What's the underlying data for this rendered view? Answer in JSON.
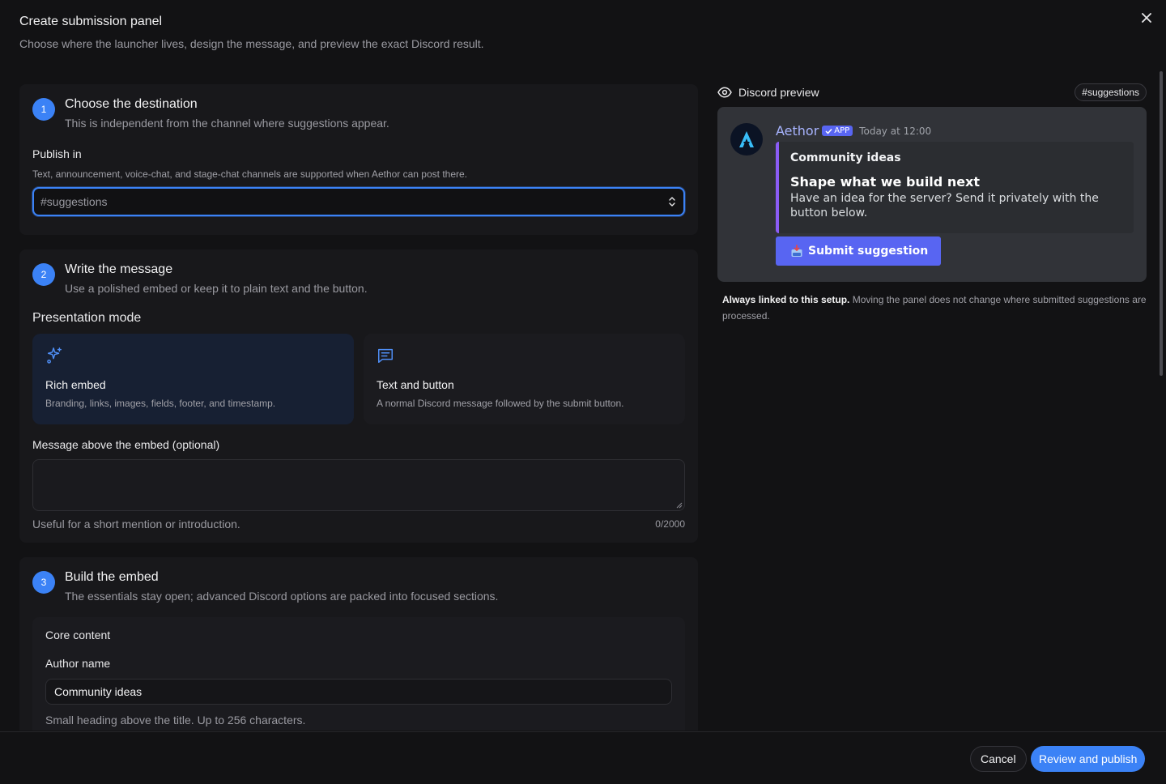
{
  "header": {
    "title": "Create submission panel",
    "subtitle": "Choose where the launcher lives, design the message, and preview the exact Discord result."
  },
  "step1": {
    "number": "1",
    "title": "Choose the destination",
    "description": "This is independent from the channel where suggestions appear.",
    "field_label": "Publish in",
    "field_help": "Text, announcement, voice-chat, and stage-chat channels are supported when Aethor can post there.",
    "select_value": "#suggestions"
  },
  "step2": {
    "number": "2",
    "title": "Write the message",
    "description": "Use a polished embed or keep it to plain text and the button.",
    "mode_label": "Presentation mode",
    "modes": [
      {
        "title": "Rich embed",
        "desc": "Branding, links, images, fields, footer, and timestamp.",
        "selected": true
      },
      {
        "title": "Text and button",
        "desc": "A normal Discord message followed by the submit button.",
        "selected": false
      }
    ],
    "message_label": "Message above the embed (optional)",
    "message_value": "",
    "message_help": "Useful for a short mention or introduction.",
    "message_count": "0/2000"
  },
  "step3": {
    "number": "3",
    "title": "Build the embed",
    "description": "The essentials stay open; advanced Discord options are packed into focused sections.",
    "core_title": "Core content",
    "author_label": "Author name",
    "author_value": "Community ideas",
    "author_help": "Small heading above the title. Up to 256 characters."
  },
  "preview": {
    "title": "Discord preview",
    "channel_chip": "#suggestions",
    "bot_name": "Aethor",
    "app_badge": "APP",
    "timestamp": "Today at 12:00",
    "embed_author": "Community ideas",
    "embed_title": "Shape what we build next",
    "embed_description": "Have an idea for the server? Send it privately with the button below.",
    "button_label": "Submit suggestion",
    "note_bold": "Always linked to this setup.",
    "note_rest": " Moving the panel does not change where submitted suggestions are processed."
  },
  "footer": {
    "cancel_label": "Cancel",
    "primary_label": "Review and publish"
  },
  "colors": {
    "accent": "#3b82f6",
    "discord_blurple": "#5865f2",
    "embed_accent": "#8b5cf6"
  }
}
